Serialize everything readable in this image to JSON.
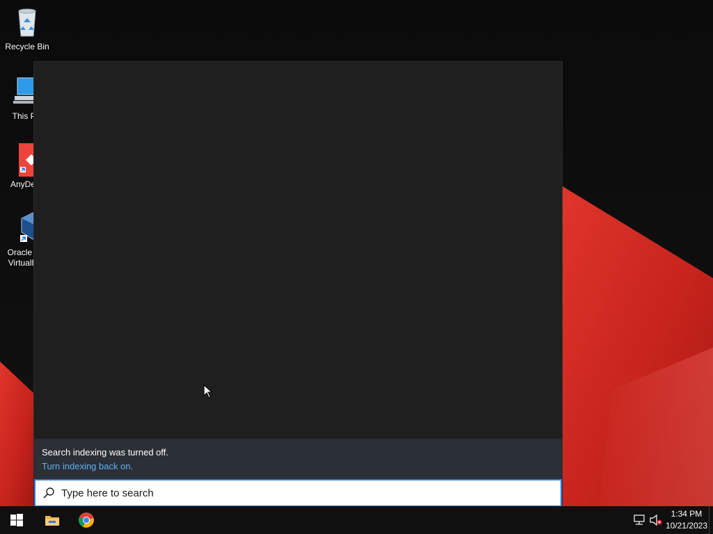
{
  "desktop": {
    "icons": [
      {
        "label": "Recycle Bin",
        "icon": "recycle-bin-icon"
      },
      {
        "label": "This PC",
        "icon": "computer-icon"
      },
      {
        "label": "AnyDesk",
        "icon": "anydesk-icon"
      },
      {
        "label": "Oracle VM VirtualBox",
        "icon": "virtualbox-icon"
      }
    ]
  },
  "search_flyout": {
    "notice_message": "Search indexing was turned off.",
    "notice_link": "Turn indexing back on.",
    "search_placeholder": "Type here to search",
    "search_value": ""
  },
  "taskbar": {
    "pinned": [
      {
        "name": "start-button",
        "icon": "windows-logo-icon"
      },
      {
        "name": "file-explorer",
        "icon": "folder-icon"
      },
      {
        "name": "google-chrome",
        "icon": "chrome-icon"
      }
    ],
    "tray": {
      "network_icon": "network-icon",
      "volume_icon": "volume-muted-icon"
    },
    "clock": {
      "time": "1:34 PM",
      "date": "10/21/2023"
    }
  },
  "colors": {
    "accent": "#2d7ee6",
    "link": "#5fb2f2",
    "wallpaper_red": "#d42a22"
  }
}
